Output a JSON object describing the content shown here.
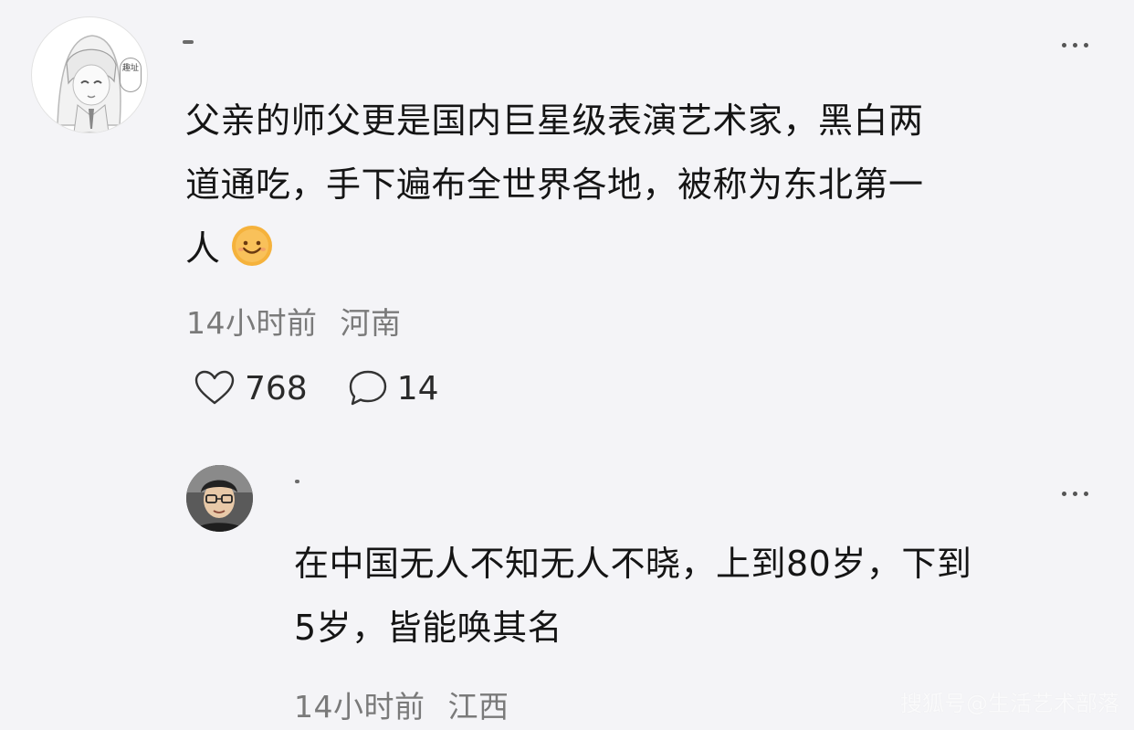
{
  "comments": [
    {
      "text_line1": "父亲的师父更是国内巨星级表演艺术家，黑白两",
      "text_line2": "道通吃，手下遍布全世界各地，被称为东北第一",
      "text_line3": "人",
      "emoji": "smile-emoji",
      "time": "14小时前",
      "location": "河南",
      "likes": "768",
      "replies": "14",
      "avatar_bubble_text": "趣址"
    },
    {
      "text_line1": "在中国无人不知无人不晓，上到80岁，下到",
      "text_line2": "5岁，皆能唤其名",
      "time": "14小时前",
      "location": "江西"
    }
  ],
  "watermark": "搜狐号@生活艺术部落",
  "icons": {
    "like": "heart-outline-icon",
    "reply": "speech-bubble-icon",
    "more": "more-dots-icon"
  },
  "colors": {
    "background": "#f4f4f7",
    "meta_text": "#7a7a7a",
    "emoji": "#f5b23c"
  }
}
